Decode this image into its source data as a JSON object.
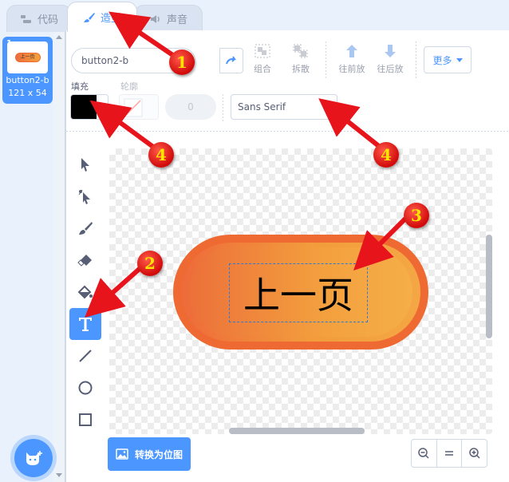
{
  "tabs": [
    {
      "label": "代码",
      "icon": "code-icon"
    },
    {
      "label": "造型",
      "icon": "brush-icon",
      "active": true
    },
    {
      "label": "声音",
      "icon": "speaker-icon"
    }
  ],
  "costume": {
    "number": "1",
    "thumb_text": "上一页",
    "name": "button2-b",
    "size": "121 x 54"
  },
  "toolbar": {
    "costume_name": "button2-b",
    "group_label": "组合",
    "ungroup_label": "拆散",
    "forward_label": "往前放",
    "backward_label": "往后放",
    "more_label": "更多"
  },
  "properties": {
    "fill_label": "填充",
    "outline_label": "轮廓",
    "fill_color": "#000000",
    "outline_width": "0",
    "font": "Sans Serif"
  },
  "canvas": {
    "text": "上一页"
  },
  "bottom": {
    "convert_label": "转换为位图"
  },
  "annotations": [
    "1",
    "2",
    "3",
    "4",
    "4"
  ]
}
